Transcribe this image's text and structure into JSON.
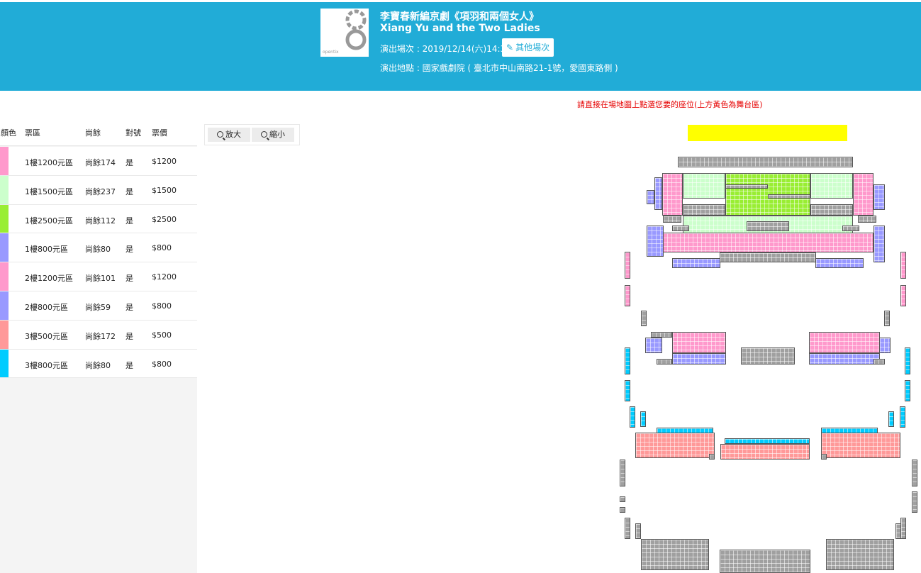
{
  "header": {
    "title_zh": "李寶春新編京劇《項羽和兩個女人》",
    "title_en": "Xiang Yu and the Two Ladies",
    "show_time": "演出場次 : 2019/12/14(六)14:30",
    "other_sessions_label": "其他場次",
    "venue": "演出地點 : 國家戲劇院 ( 臺北市中山南路21-1號，愛國東路側 )",
    "logo_text": "opentix"
  },
  "instruction": "請直接在場地圖上點選您要的座位(上方黃色為舞台區)",
  "legend": {
    "columns": [
      "顏色",
      "票區",
      "尚餘",
      "對號",
      "票價"
    ],
    "rows": [
      {
        "zone": "1樓1200元區",
        "remain": "尚餘174",
        "assigned": "是",
        "price": "$1200",
        "color": "#ff99cc"
      },
      {
        "zone": "1樓1500元區",
        "remain": "尚餘237",
        "assigned": "是",
        "price": "$1500",
        "color": "#ccffcc"
      },
      {
        "zone": "1樓2500元區",
        "remain": "尚餘112",
        "assigned": "是",
        "price": "$2500",
        "color": "#99ee33"
      },
      {
        "zone": "1樓800元區",
        "remain": "尚餘80",
        "assigned": "是",
        "price": "$800",
        "color": "#9999ff"
      },
      {
        "zone": "2樓1200元區",
        "remain": "尚餘101",
        "assigned": "是",
        "price": "$1200",
        "color": "#ff99cc"
      },
      {
        "zone": "2樓800元區",
        "remain": "尚餘59",
        "assigned": "是",
        "price": "$800",
        "color": "#9999ff"
      },
      {
        "zone": "3樓500元區",
        "remain": "尚餘172",
        "assigned": "是",
        "price": "$500",
        "color": "#ff9999"
      },
      {
        "zone": "3樓800元區",
        "remain": "尚餘80",
        "assigned": "是",
        "price": "$800",
        "color": "#00ccff"
      }
    ]
  },
  "zoom": {
    "in_label": "放大",
    "out_label": "縮小"
  },
  "seat_colors": {
    "pink": "#ff99cc",
    "lightgreen": "#ccffcc",
    "green": "#99ee33",
    "purple": "#9999ff",
    "salmon": "#ff9999",
    "cyan": "#00ccff",
    "sold": "#a0a0a0",
    "stage": "#ffff00"
  }
}
